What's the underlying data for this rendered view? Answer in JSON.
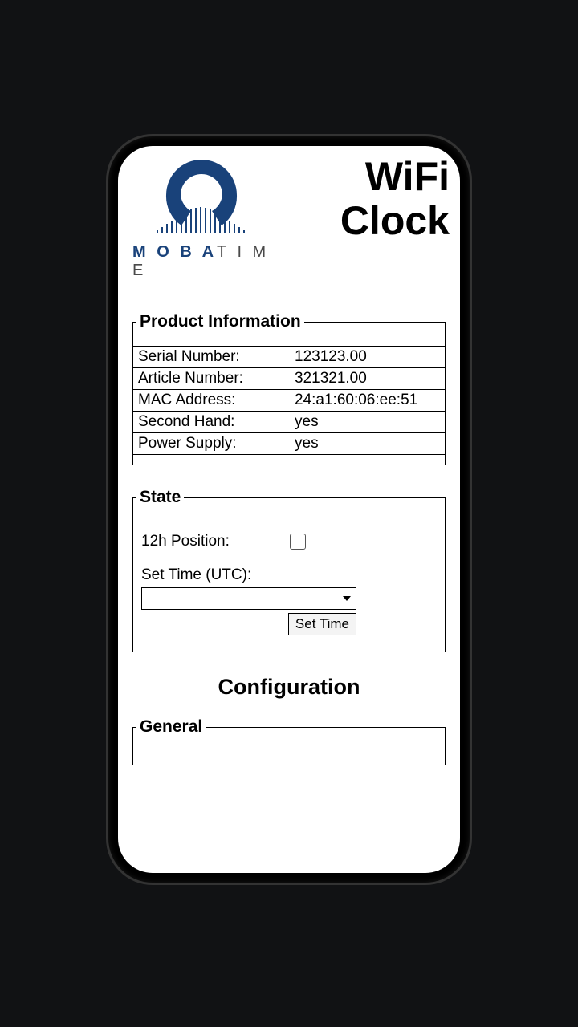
{
  "header": {
    "logo_brand_moba": "M O B A",
    "logo_brand_time": "T I M E",
    "title": "WiFi Clock"
  },
  "product_info": {
    "legend": "Product Information",
    "rows": [
      {
        "label": "Serial Number:",
        "value": "123123.00"
      },
      {
        "label": "Article Number:",
        "value": "321321.00"
      },
      {
        "label": "MAC Address:",
        "value": "24:a1:60:06:ee:51"
      },
      {
        "label": "Second Hand:",
        "value": "yes"
      },
      {
        "label": "Power Supply:",
        "value": "yes"
      }
    ]
  },
  "state": {
    "legend": "State",
    "position_label": "12h Position:",
    "position_checked": false,
    "set_time_label": "Set Time (UTC):",
    "dropdown_value": "",
    "button_label": "Set Time"
  },
  "config": {
    "title": "Configuration",
    "general_legend": "General"
  }
}
